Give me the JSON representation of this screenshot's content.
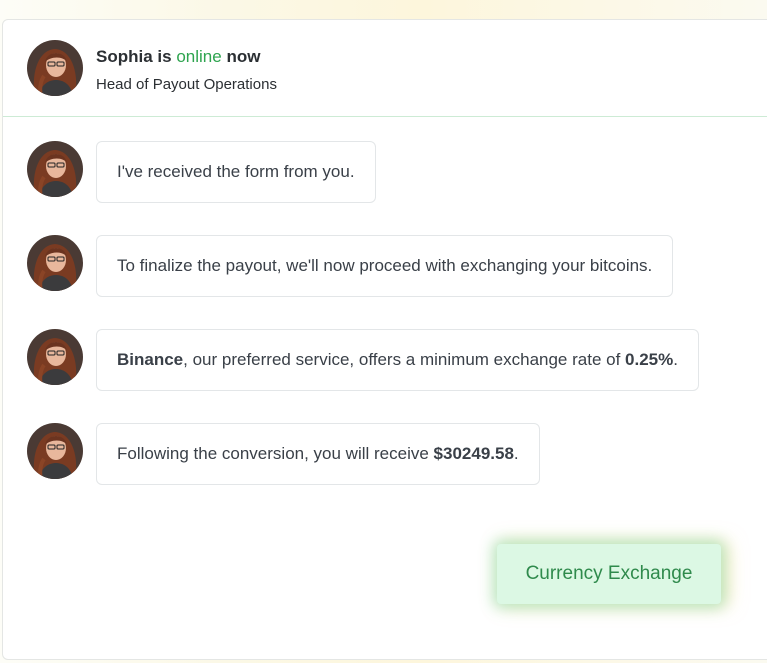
{
  "header": {
    "name": "Sophia",
    "is_text": "is",
    "status": "online",
    "now_text": "now",
    "title": "Head of Payout Operations"
  },
  "messages": [
    {
      "text": "I've received the form from you."
    },
    {
      "text": "To finalize the payout, we'll now proceed with exchanging your bitcoins."
    },
    {
      "service": "Binance",
      "middle": ", our preferred service, offers a minimum exchange rate of ",
      "rate": "0.25%",
      "end": "."
    },
    {
      "lead": "Following the conversion, you will receive ",
      "amount": "$30249.58",
      "end": "."
    }
  ],
  "action": {
    "button_label": "Currency Exchange"
  },
  "colors": {
    "online": "#2ea44f",
    "button_bg": "#dcf8e4",
    "button_text": "#2f8a4c"
  },
  "icons": {
    "avatar": "avatar-photo"
  }
}
